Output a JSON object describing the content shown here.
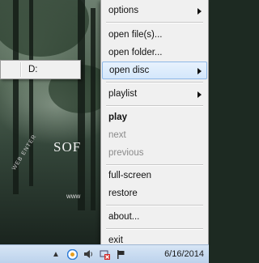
{
  "menu": {
    "items": [
      {
        "label": "options"
      },
      {
        "label": "open file(s)..."
      },
      {
        "label": "open folder..."
      },
      {
        "label": "open disc"
      },
      {
        "label": "playlist"
      },
      {
        "label": "play"
      },
      {
        "label": "next"
      },
      {
        "label": "previous"
      },
      {
        "label": "full-screen"
      },
      {
        "label": "restore"
      },
      {
        "label": "about..."
      },
      {
        "label": "exit"
      }
    ]
  },
  "submenu": {
    "items": [
      {
        "label": "D:"
      }
    ]
  },
  "video": {
    "overlay_title": "SOF",
    "overlay_small": "www",
    "overlay_diag": "WEB ENTER"
  },
  "taskbar": {
    "clock": "6/16/2014"
  },
  "colors": {
    "menu_bg": "#f0f0f0",
    "highlight": "#d4e7fb",
    "highlight_border": "#8fb8e6",
    "disabled_text": "#8a8a8a"
  }
}
